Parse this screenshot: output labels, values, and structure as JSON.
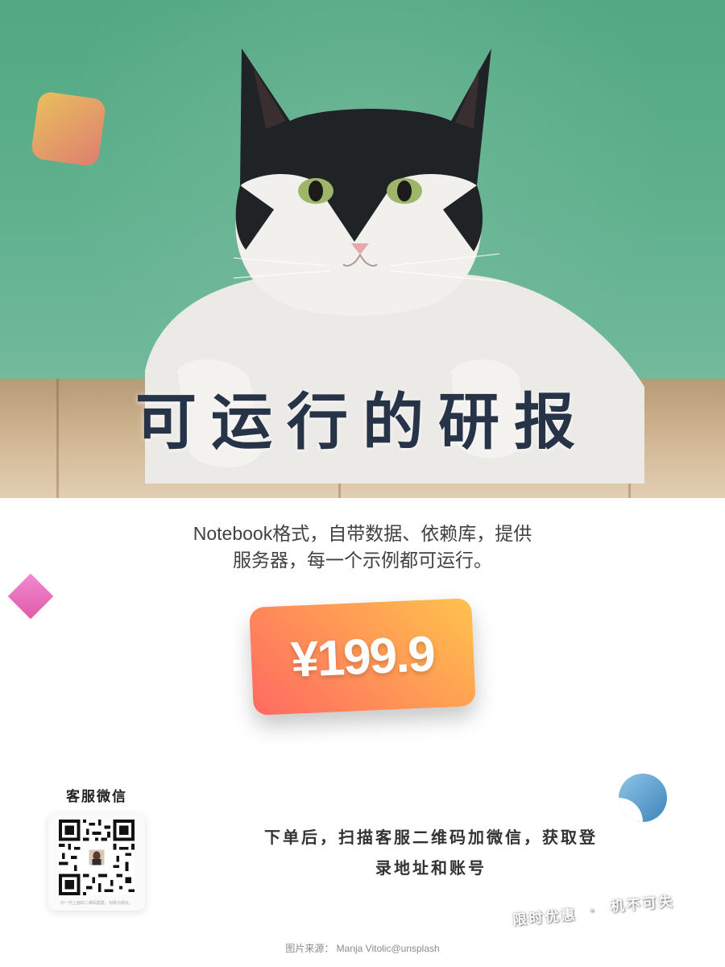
{
  "hero": {
    "title": "可运行的研报",
    "photo_subject": "cat-photo"
  },
  "description": {
    "line1": "Notebook格式，自带数据、依赖库，提供",
    "line2": "服务器，每一个示例都可运行。"
  },
  "price": {
    "value": "¥199.9"
  },
  "qr": {
    "label": "客服微信",
    "caption": "扫一扫上面的二维码图案，加我为朋友。"
  },
  "instructions": {
    "line1": "下单后，扫描客服二维码加微信，获取登",
    "line2": "录地址和账号"
  },
  "promo": {
    "left": "限时优惠",
    "right": "机不可失"
  },
  "credit": {
    "text": "图片来源：  Manja Vitolic@unsplash"
  },
  "colors": {
    "hero_bg": "#5fb08d",
    "title": "#273447",
    "price_gradient_start": "#ff6a62",
    "price_gradient_end": "#ffc24d",
    "diamond": "#e56fb8",
    "circle": "#4a90c4"
  }
}
